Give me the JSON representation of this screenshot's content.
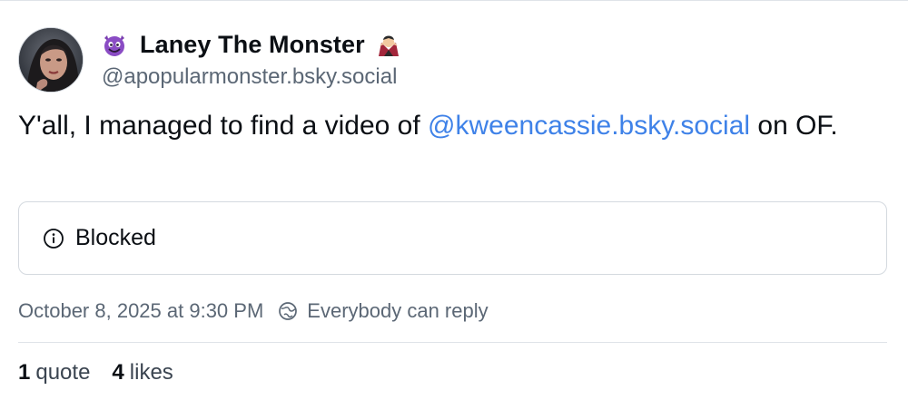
{
  "author": {
    "display_name": "Laney The Monster",
    "handle": "@apopularmonster.bsky.social",
    "lead_emoji": "smiling-devil-emoji",
    "trail_emoji": "vampire-emoji"
  },
  "post": {
    "text_before": "Y'all, I managed to find a video of ",
    "mention": "@kweencassie.bsky.social",
    "text_after": " on OF."
  },
  "embed": {
    "icon": "info-circle-icon",
    "label": "Blocked"
  },
  "meta": {
    "timestamp": "October 8, 2025 at 9:30 PM",
    "reply_icon": "globe-icon",
    "reply_setting": "Everybody can reply"
  },
  "stats": {
    "quotes_count": "1",
    "quotes_label": "quote",
    "likes_count": "4",
    "likes_label": "likes"
  },
  "colors": {
    "link": "#3f82e8",
    "muted": "#5b6775",
    "border": "#d4d9df"
  }
}
